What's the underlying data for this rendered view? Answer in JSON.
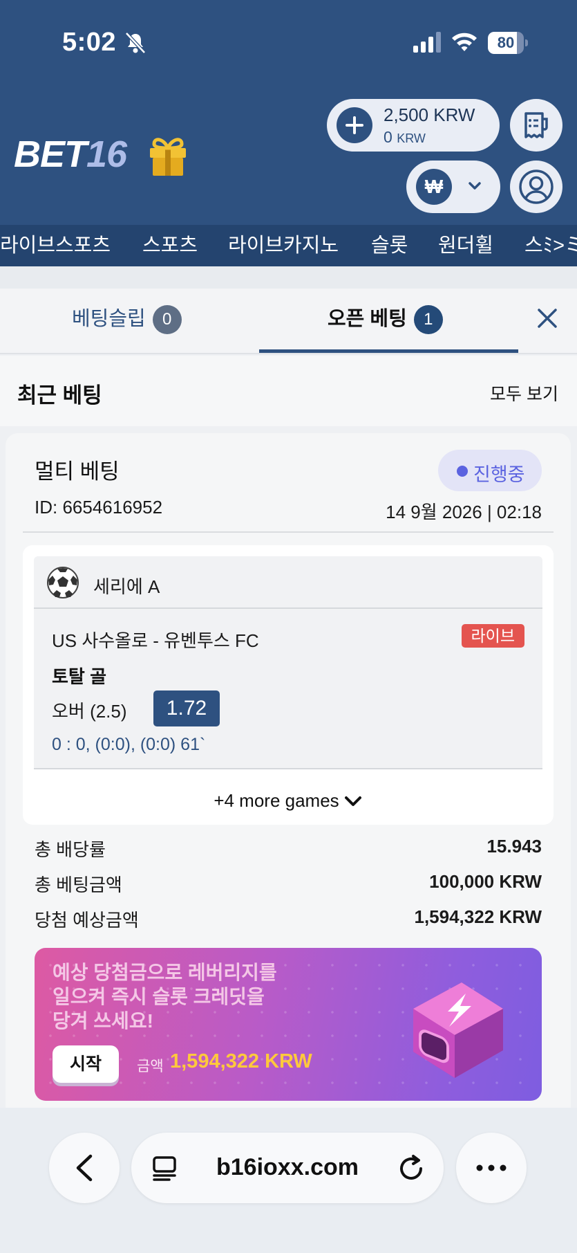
{
  "status_bar": {
    "time": "5:02",
    "battery": "80",
    "battery_level": 0.8
  },
  "header": {
    "logo_main": "BET",
    "logo_num": "16",
    "balance_main": "2,500 KRW",
    "balance_sub_value": "0",
    "balance_sub_unit": "KRW",
    "currency_symbol": "₩"
  },
  "nav": {
    "items": [
      "라이브스포츠",
      "스포츠",
      "라이브카지노",
      "슬롯",
      "원더휠",
      "스ﾐ>ミ"
    ]
  },
  "tabs": {
    "betslip_label": "베팅슬립",
    "betslip_count": "0",
    "open_label": "오픈 베팅",
    "open_count": "1"
  },
  "recent": {
    "title": "최근 베팅",
    "view_all": "모두 보기"
  },
  "bet": {
    "type": "멀티 베팅",
    "status": "진행중",
    "id": "ID: 6654616952",
    "date": "14 9월 2026 | 02:18",
    "league": "세리에 A",
    "match": "US 사수올로 - 유벤투스 FC",
    "live": "라이브",
    "market": "토탈 골",
    "selection": "오버 (2.5)",
    "odds": "1.72",
    "score": "0 : 0, (0:0), (0:0) 61`",
    "more_games": "+4 more games"
  },
  "summary": {
    "total_odds_label": "총 배당률",
    "total_odds": "15.943",
    "total_stake_label": "총 베팅금액",
    "total_stake": "100,000 KRW",
    "payout_label": "당첨 예상금액",
    "payout": "1,594,322 KRW"
  },
  "promo": {
    "text": "예상 당첨금으로 레버리지를 일으켜 즉시 슬롯 크레딧을 당겨 쓰세요!",
    "button": "시작",
    "amount_label": "금액",
    "amount": "1,594,322 KRW"
  },
  "browser": {
    "url": "b16ioxx.com"
  },
  "colors": {
    "primary": "#2e5180",
    "live_red": "#e4544f",
    "status_purple": "#5b63e0",
    "promo_gold": "#ffc93c"
  }
}
